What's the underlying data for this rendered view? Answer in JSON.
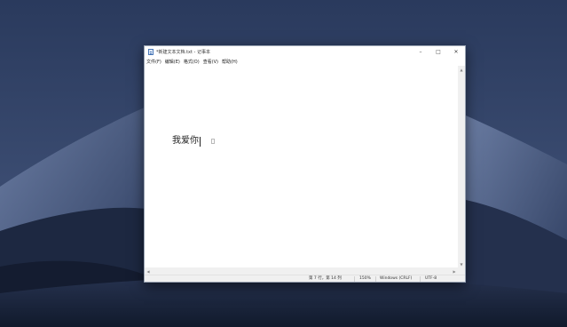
{
  "window": {
    "title": "*新建文本文档.txt - 记事本",
    "controls": {
      "minimize": "–",
      "maximize": "□",
      "close": "✕"
    }
  },
  "menu": [
    "文件(F)",
    "编辑(E)",
    "格式(O)",
    "查看(V)",
    "帮助(H)"
  ],
  "editor": {
    "content": "我爱你"
  },
  "status": {
    "position": "第 7 行，第 14 列",
    "zoom": "150%",
    "line_ending": "Windows (CRLF)",
    "encoding": "UTF-8"
  },
  "colors": {
    "desktop_sky": "#2b3b5e",
    "dune_dark": "#121a2e",
    "dune_light": "#5d6f96"
  }
}
